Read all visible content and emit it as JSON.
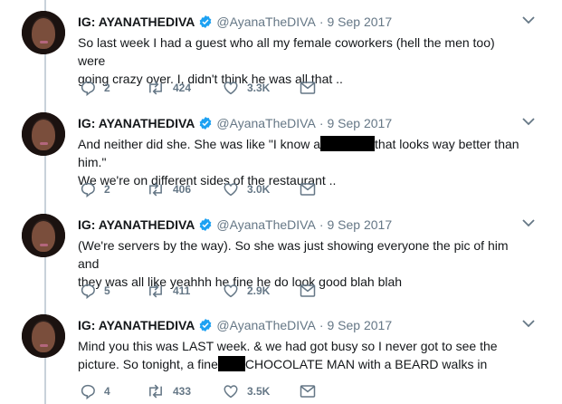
{
  "tweets": [
    {
      "name": "IG: AYANATHEDIVA",
      "handle": "@AyanaTheDIVA",
      "separator": "·",
      "date": "9 Sep 2017",
      "line1": "So last week I had a guest who all my female coworkers (hell the men too) were",
      "line2": "going crazy over. I, didn't think he was all that ..",
      "replies": "2",
      "retweets": "424",
      "likes": "3.3K"
    },
    {
      "name": "IG: AYANATHEDIVA",
      "handle": "@AyanaTheDIVA",
      "separator": "·",
      "date": "9 Sep 2017",
      "line1a": "And neither did she. She was like \"I know a",
      "line1b": "that looks way better than him.\"",
      "line2": "We we're on different sides of the restaurant ..",
      "replies": "2",
      "retweets": "406",
      "likes": "3.0K"
    },
    {
      "name": "IG: AYANATHEDIVA",
      "handle": "@AyanaTheDIVA",
      "separator": "·",
      "date": "9 Sep 2017",
      "line1": "(We're servers by the way). So she was just showing everyone the pic of him and",
      "line2": "they was all like yeahhh he fine he do look good blah blah",
      "replies": "5",
      "retweets": "411",
      "likes": "2.9K"
    },
    {
      "name": "IG: AYANATHEDIVA",
      "handle": "@AyanaTheDIVA",
      "separator": "·",
      "date": "9 Sep 2017",
      "line1": "Mind you this was LAST week. & we had got busy so I never got to see the",
      "line2a": "picture. So tonight, a fine",
      "line2b": "CHOCOLATE MAN with a BEARD walks in",
      "replies": "4",
      "retweets": "433",
      "likes": "3.5K"
    }
  ],
  "colors": {
    "text": "#14171a",
    "secondary": "#657786",
    "verified": "#1da1f2",
    "thread_line": "#c8d2da"
  },
  "icons": [
    "reply-icon",
    "retweet-icon",
    "like-icon",
    "direct-message-icon",
    "verified-badge-icon",
    "chevron-down-icon"
  ]
}
